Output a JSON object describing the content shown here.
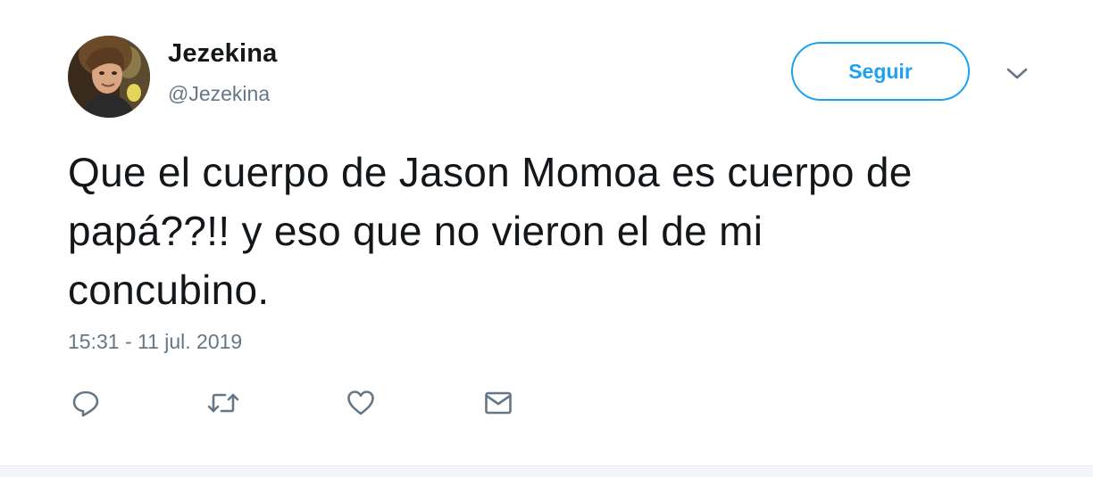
{
  "tweet": {
    "author": {
      "display_name": "Jezekina",
      "handle": "@Jezekina",
      "avatar_icon": "user-avatar-photo"
    },
    "follow_label": "Seguir",
    "menu_icon": "chevron-down-icon",
    "text_lines": [
      "Que el cuerpo de Jason Momoa es cuerpo de",
      "papá??!! y eso que no vieron el de mi",
      "concubino."
    ],
    "timestamp": "15:31 - 11 jul. 2019",
    "actions": [
      {
        "name": "reply",
        "icon": "reply-icon"
      },
      {
        "name": "retweet",
        "icon": "retweet-icon"
      },
      {
        "name": "like",
        "icon": "heart-icon"
      },
      {
        "name": "direct-message",
        "icon": "envelope-icon"
      }
    ]
  },
  "colors": {
    "accent": "#1da1f2",
    "text": "#14171a",
    "secondary_text": "#657786",
    "icon": "#657786",
    "background": "#ffffff"
  }
}
